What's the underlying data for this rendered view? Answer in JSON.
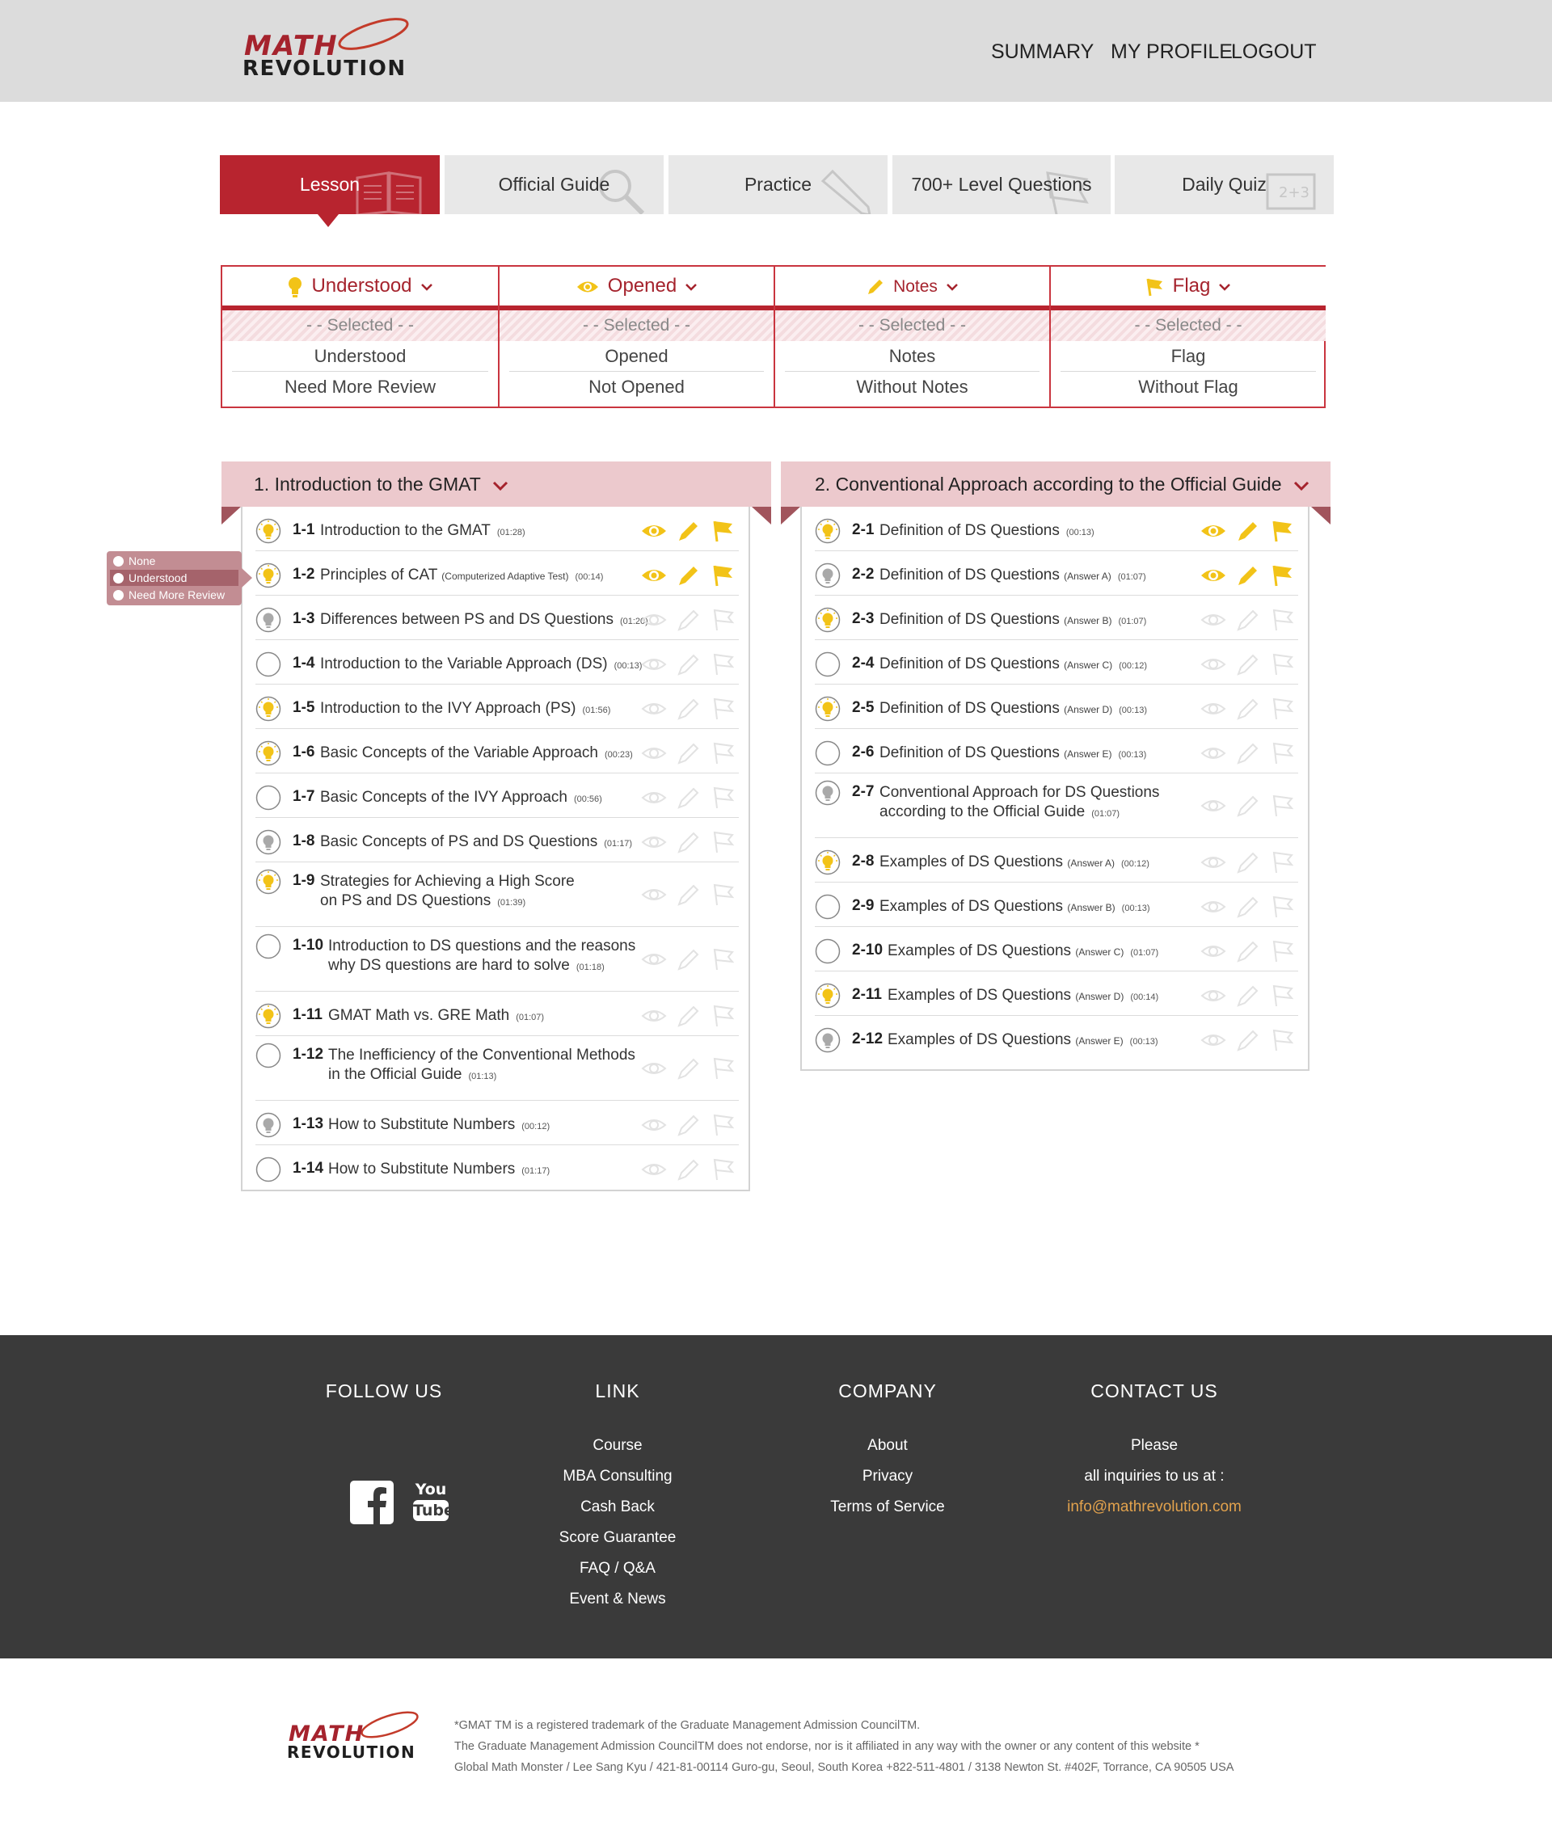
{
  "brand": {
    "math": "MATH",
    "revolution": "REVOLUTION"
  },
  "topnav": {
    "summary": "SUMMARY",
    "profile": "MY PROFILE",
    "logout": "LOGOUT"
  },
  "tabs": [
    {
      "label": "Lesson",
      "active": true
    },
    {
      "label": "Official Guide",
      "active": false
    },
    {
      "label": "Practice",
      "active": false
    },
    {
      "label": "700+ Level Questions",
      "active": false
    },
    {
      "label": "Daily Quiz",
      "active": false
    }
  ],
  "filters": [
    {
      "header": "Understood",
      "selected": "- - Selected - -",
      "options": [
        "Understood",
        "Need More Review"
      ]
    },
    {
      "header": "Opened",
      "selected": "- - Selected - -",
      "options": [
        "Opened",
        "Not Opened"
      ]
    },
    {
      "header": "Notes",
      "selected": "- - Selected - -",
      "options": [
        "Notes",
        "Without Notes"
      ]
    },
    {
      "header": "Flag",
      "selected": "- - Selected - -",
      "options": [
        "Flag",
        "Without Flag"
      ]
    }
  ],
  "popup": {
    "items": [
      "None",
      "Understood",
      "Need More Review"
    ],
    "selected": "Understood"
  },
  "sections": [
    {
      "title": "1. Introduction to the GMAT",
      "lessons": [
        {
          "num": "1-1",
          "title": "Introduction to the GMAT",
          "sub": "",
          "tag": "",
          "dur": "(01:28)",
          "status": "understood",
          "opened": true,
          "notes": true,
          "flag": true
        },
        {
          "num": "1-2",
          "title": "Principles of CAT",
          "sub": "",
          "tag": "(Computerized Adaptive Test)",
          "dur": "(00:14)",
          "status": "understood",
          "opened": true,
          "notes": true,
          "flag": true
        },
        {
          "num": "1-3",
          "title": "Differences between PS and DS Questions",
          "sub": "",
          "tag": "",
          "dur": "(01:20)",
          "status": "review",
          "opened": false,
          "notes": false,
          "flag": false
        },
        {
          "num": "1-4",
          "title": "Introduction to the Variable Approach (DS)",
          "sub": "",
          "tag": "",
          "dur": "(00:13)",
          "status": "none",
          "opened": false,
          "notes": false,
          "flag": false
        },
        {
          "num": "1-5",
          "title": "Introduction to the IVY Approach (PS)",
          "sub": "",
          "tag": "",
          "dur": "(01:56)",
          "status": "understood",
          "opened": false,
          "notes": false,
          "flag": false
        },
        {
          "num": "1-6",
          "title": "Basic Concepts of the Variable Approach",
          "sub": "",
          "tag": "",
          "dur": "(00:23)",
          "status": "understood",
          "opened": false,
          "notes": false,
          "flag": false
        },
        {
          "num": "1-7",
          "title": "Basic Concepts of the IVY Approach",
          "sub": "",
          "tag": "",
          "dur": "(00:56)",
          "status": "none",
          "opened": false,
          "notes": false,
          "flag": false
        },
        {
          "num": "1-8",
          "title": "Basic Concepts of PS and DS Questions",
          "sub": "",
          "tag": "",
          "dur": "(01:17)",
          "status": "review",
          "opened": false,
          "notes": false,
          "flag": false
        },
        {
          "num": "1-9",
          "title": "Strategies for Achieving a High Score",
          "sub": "on PS and DS Questions",
          "tag": "",
          "dur": "(01:39)",
          "status": "understood",
          "opened": false,
          "notes": false,
          "flag": false
        },
        {
          "num": "1-10",
          "title": "Introduction to DS questions and the reasons",
          "sub": "why DS questions are hard to solve",
          "tag": "",
          "dur": "(01:18)",
          "status": "none",
          "opened": false,
          "notes": false,
          "flag": false
        },
        {
          "num": "1-11",
          "title": "GMAT Math vs. GRE Math",
          "sub": "",
          "tag": "",
          "dur": "(01:07)",
          "status": "understood",
          "opened": false,
          "notes": false,
          "flag": false
        },
        {
          "num": "1-12",
          "title": "The Inefficiency of the Conventional Methods",
          "sub": "in the Official Guide",
          "tag": "",
          "dur": "(01:13)",
          "status": "none",
          "opened": false,
          "notes": false,
          "flag": false
        },
        {
          "num": "1-13",
          "title": "How to Substitute Numbers",
          "sub": "",
          "tag": "",
          "dur": "(00:12)",
          "status": "review",
          "opened": false,
          "notes": false,
          "flag": false
        },
        {
          "num": "1-14",
          "title": "How to Substitute Numbers",
          "sub": "",
          "tag": "",
          "dur": "(01:17)",
          "status": "none",
          "opened": false,
          "notes": false,
          "flag": false
        }
      ]
    },
    {
      "title": "2. Conventional Approach according to the Official Guide",
      "lessons": [
        {
          "num": "2-1",
          "title": "Definition of DS Questions",
          "sub": "",
          "tag": "",
          "dur": "(00:13)",
          "status": "understood",
          "opened": true,
          "notes": true,
          "flag": true
        },
        {
          "num": "2-2",
          "title": "Definition of DS Questions",
          "sub": "",
          "tag": "(Answer A)",
          "dur": "(01:07)",
          "status": "review",
          "opened": true,
          "notes": true,
          "flag": true
        },
        {
          "num": "2-3",
          "title": "Definition of DS Questions",
          "sub": "",
          "tag": "(Answer B)",
          "dur": "(01:07)",
          "status": "understood",
          "opened": false,
          "notes": false,
          "flag": false
        },
        {
          "num": "2-4",
          "title": "Definition of DS Questions",
          "sub": "",
          "tag": "(Answer C)",
          "dur": "(00:12)",
          "status": "none",
          "opened": false,
          "notes": false,
          "flag": false
        },
        {
          "num": "2-5",
          "title": "Definition of DS Questions",
          "sub": "",
          "tag": "(Answer D)",
          "dur": "(00:13)",
          "status": "understood",
          "opened": false,
          "notes": false,
          "flag": false
        },
        {
          "num": "2-6",
          "title": "Definition of DS Questions",
          "sub": "",
          "tag": "(Answer E)",
          "dur": "(00:13)",
          "status": "none",
          "opened": false,
          "notes": false,
          "flag": false
        },
        {
          "num": "2-7",
          "title": "Conventional Approach for DS Questions",
          "sub": "according to the Official Guide",
          "tag": "",
          "dur": "(01:07)",
          "status": "review",
          "opened": false,
          "notes": false,
          "flag": false
        },
        {
          "num": "2-8",
          "title": "Examples of DS Questions",
          "sub": "",
          "tag": "(Answer A)",
          "dur": "(00:12)",
          "status": "understood",
          "opened": false,
          "notes": false,
          "flag": false
        },
        {
          "num": "2-9",
          "title": "Examples of DS Questions",
          "sub": "",
          "tag": "(Answer B)",
          "dur": "(00:13)",
          "status": "none",
          "opened": false,
          "notes": false,
          "flag": false
        },
        {
          "num": "2-10",
          "title": "Examples of DS Questions",
          "sub": "",
          "tag": "(Answer C)",
          "dur": "(01:07)",
          "status": "none",
          "opened": false,
          "notes": false,
          "flag": false
        },
        {
          "num": "2-11",
          "title": "Examples of DS Questions",
          "sub": "",
          "tag": "(Answer D)",
          "dur": "(00:14)",
          "status": "understood",
          "opened": false,
          "notes": false,
          "flag": false
        },
        {
          "num": "2-12",
          "title": "Examples of DS Questions",
          "sub": "",
          "tag": "(Answer E)",
          "dur": "(00:13)",
          "status": "review",
          "opened": false,
          "notes": false,
          "flag": false
        }
      ]
    }
  ],
  "footer": {
    "follow": {
      "title": "FOLLOW  US",
      "youtube_top": "You",
      "youtube_bottom": "Tube"
    },
    "link": {
      "title": "LINK",
      "items": [
        "Course",
        "MBA Consulting",
        "Cash Back",
        "Score Guarantee",
        "FAQ / Q&A",
        "Event & News"
      ]
    },
    "company": {
      "title": "COMPANY",
      "items": [
        "About",
        "Privacy",
        "Terms  of  Service"
      ]
    },
    "contact": {
      "title": "CONTACT  US",
      "line1": "Please",
      "line2": "all inquiries to us at :",
      "email": "info@mathrevolution.com"
    }
  },
  "legal": [
    "*GMAT TM is a registered trademark of the Graduate Management Admission CouncilTM.",
    "The Graduate Management Admission CouncilTM does not endorse, nor is it affiliated in any way with the owner or any content of this website *",
    "Global Math Monster / Lee Sang Kyu / 421-81-00114 Guro-gu, Seoul, South Korea +822-511-4801 / 3138 Newton St. #402F, Torrance, CA 90505 USA"
  ],
  "colors": {
    "brand_red": "#b8242f",
    "accent_yellow": "#f2c318",
    "footer_bg": "#3a3a3a",
    "email": "#e2a24d"
  }
}
